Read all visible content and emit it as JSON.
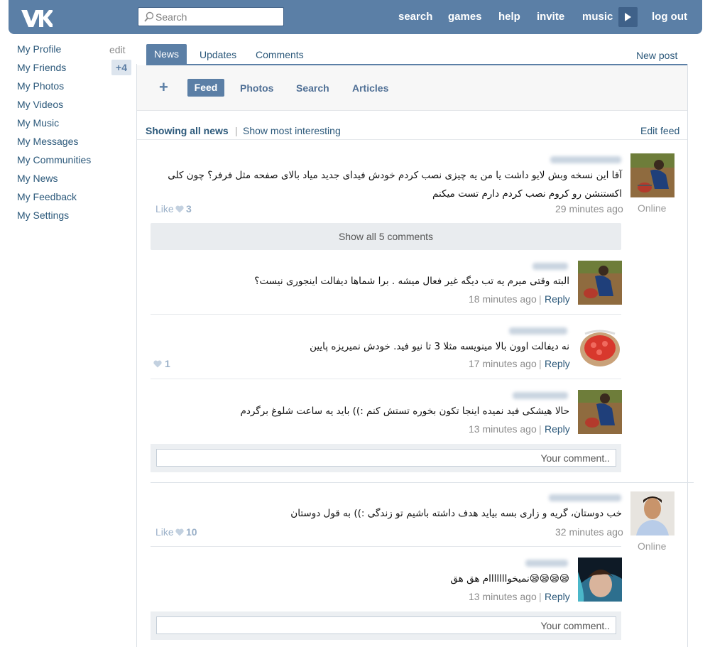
{
  "header": {
    "search_placeholder": "Search",
    "nav": [
      "search",
      "games",
      "help",
      "invite",
      "music"
    ],
    "logout": "log out"
  },
  "sidebar": {
    "items": [
      {
        "label": "My Profile"
      },
      {
        "label": "My Friends"
      },
      {
        "label": "My Photos"
      },
      {
        "label": "My Videos"
      },
      {
        "label": "My Music"
      },
      {
        "label": "My Messages"
      },
      {
        "label": "My Communities"
      },
      {
        "label": "My News"
      },
      {
        "label": "My Feedback"
      },
      {
        "label": "My Settings"
      }
    ],
    "edit_label": "edit",
    "friends_badge": "+4"
  },
  "tabs": {
    "active": "News",
    "updates": "Updates",
    "comments": "Comments",
    "new_post": "New post"
  },
  "filters": {
    "plus": "+",
    "active": "Feed",
    "photos": "Photos",
    "search": "Search",
    "articles": "Articles"
  },
  "feed_head": {
    "showing_all": "Showing all news",
    "separator": "|",
    "show_interesting": "Show most interesting",
    "edit_feed": "Edit feed"
  },
  "posts": [
    {
      "text": "آقا این نسخه وبش لایو داشت یا من یه چیزی نصب کردم خودش فیدای جدید میاد بالای صفحه مثل فرفر؟ چون کلی اکستنشن رو کروم نصب کردم دارم تست میکنم",
      "like_label": "Like",
      "likes": "3",
      "time": "29 minutes ago",
      "status": "Online",
      "show_all": "Show all 5 comments",
      "comments": [
        {
          "text": "البته وقتی میرم یه تب دیگه غیر فعال میشه . برا شماها دیفالت اینجوری نیست؟",
          "time": "18 minutes ago",
          "reply": "Reply"
        },
        {
          "text": "نه دیفالت اوون بالا مینویسه مثلا 3 تا نیو فید. خودش نمیریزه پایین",
          "time": "17 minutes ago",
          "reply": "Reply",
          "likes": "1"
        },
        {
          "text": "حالا هیشکی فید نمیده اینجا تکون بخوره تستش کنم :)) باید یه ساعت شلوغ برگردم",
          "time": "13 minutes ago",
          "reply": "Reply"
        }
      ],
      "comment_placeholder": "Your comment.."
    },
    {
      "text": "خب دوستان، گریه و زاری بسه بیاید هدف داشته باشیم تو زندگی :)) به قول دوستان",
      "like_label": "Like",
      "likes": "10",
      "time": "32 minutes ago",
      "status": "Online",
      "comments": [
        {
          "text": "😪😪😪😪نمیخوااااااام هق هق",
          "time": "13 minutes ago",
          "reply": "Reply"
        }
      ],
      "comment_placeholder": "Your comment.."
    }
  ],
  "colors": {
    "brand": "#5b7fa6",
    "link": "#2b587a",
    "muted": "#8c8c8c"
  },
  "icons": [
    "vk-logo-icon",
    "search-icon",
    "play-icon",
    "heart-icon"
  ]
}
